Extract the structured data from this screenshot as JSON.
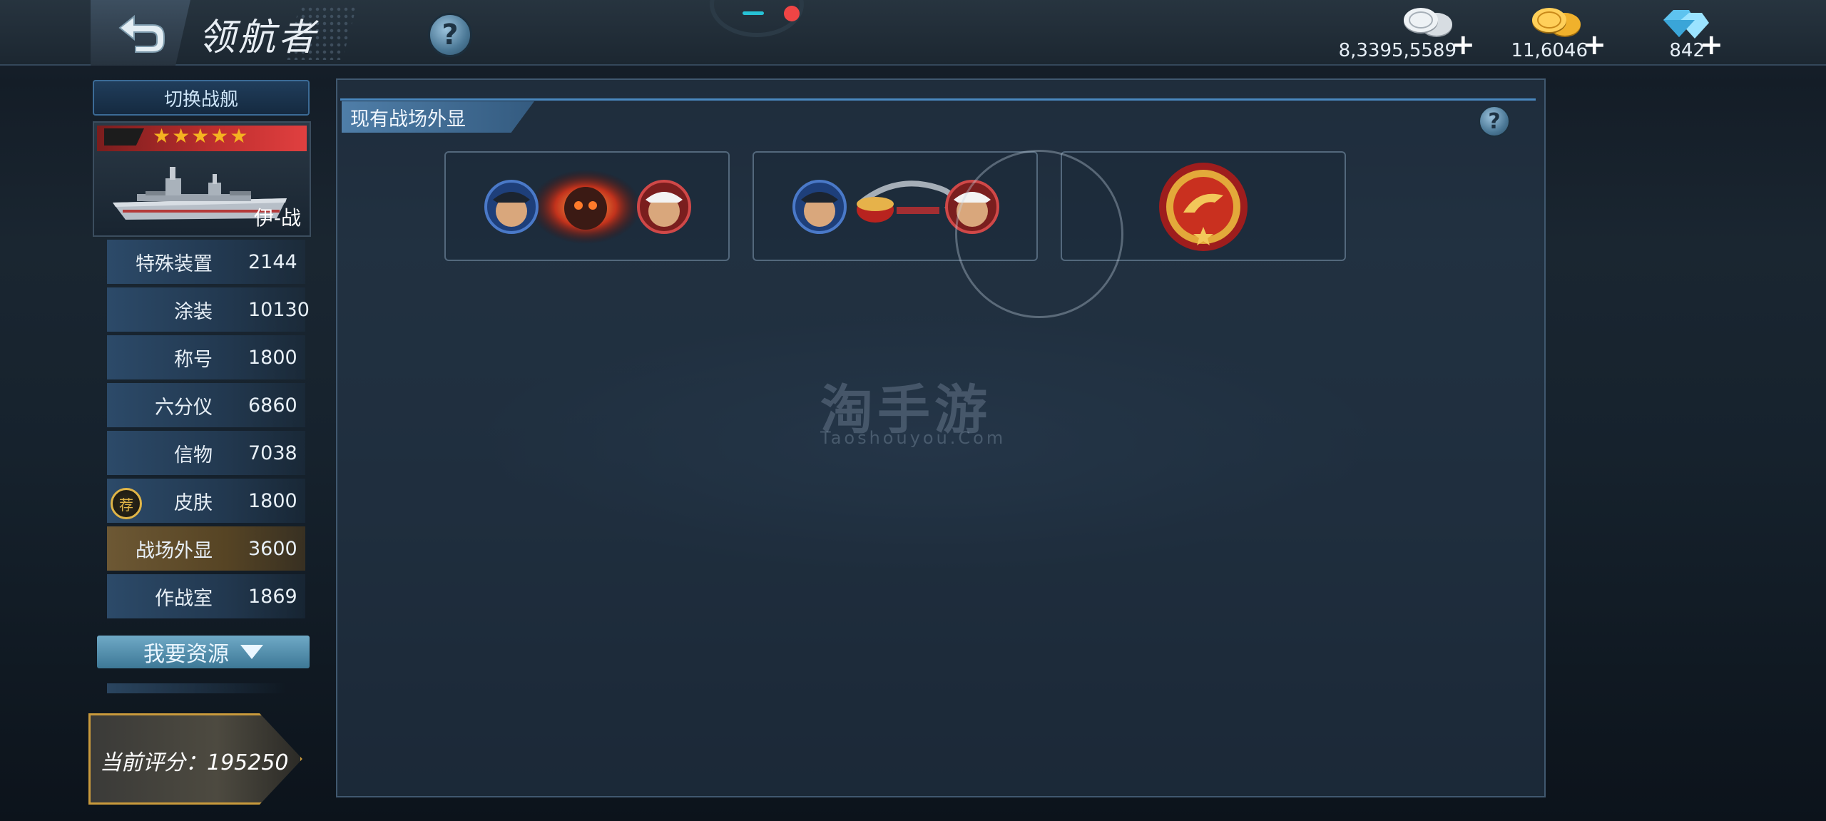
{
  "header": {
    "title": "领航者",
    "help_icon": "?",
    "currencies": [
      {
        "name": "silver-coins",
        "value": "8,3395,5589",
        "color": "#c9cfd6"
      },
      {
        "name": "gold-coins",
        "value": "11,6046",
        "color": "#f2b72f"
      },
      {
        "name": "diamonds",
        "value": "842",
        "color": "#7fd3f5"
      }
    ],
    "plus": "+"
  },
  "sidebar": {
    "switch_label": "切换战舰",
    "ship": {
      "name": "伊-战",
      "stars": "★★★★★",
      "rating": 5
    },
    "items": [
      {
        "label": "特殊装置",
        "value": "2144"
      },
      {
        "label": "涂装",
        "value": "10130"
      },
      {
        "label": "称号",
        "value": "1800"
      },
      {
        "label": "六分仪",
        "value": "6860"
      },
      {
        "label": "信物",
        "value": "7038"
      },
      {
        "label": "皮肤",
        "value": "1800",
        "badge": "荐"
      },
      {
        "label": "战场外显",
        "value": "3600",
        "active": true
      },
      {
        "label": "作战室",
        "value": "1869"
      }
    ],
    "resource_button": "我要资源",
    "score": "当前评分：195250"
  },
  "main": {
    "section_title": "现有战场外显",
    "help_icon": "?",
    "slots": [
      {
        "name": "fire-skull-effect-slot"
      },
      {
        "name": "drum-ribbon-effect-slot"
      },
      {
        "name": "golden-emblem-slot"
      }
    ]
  },
  "watermark": {
    "main": "淘手游",
    "sub": "Taoshouyou.Com"
  },
  "colors": {
    "accent": "#4a88bf",
    "active_tab": "#6d5834",
    "star": "#f5b321",
    "badge_ring": "#e0b547"
  }
}
